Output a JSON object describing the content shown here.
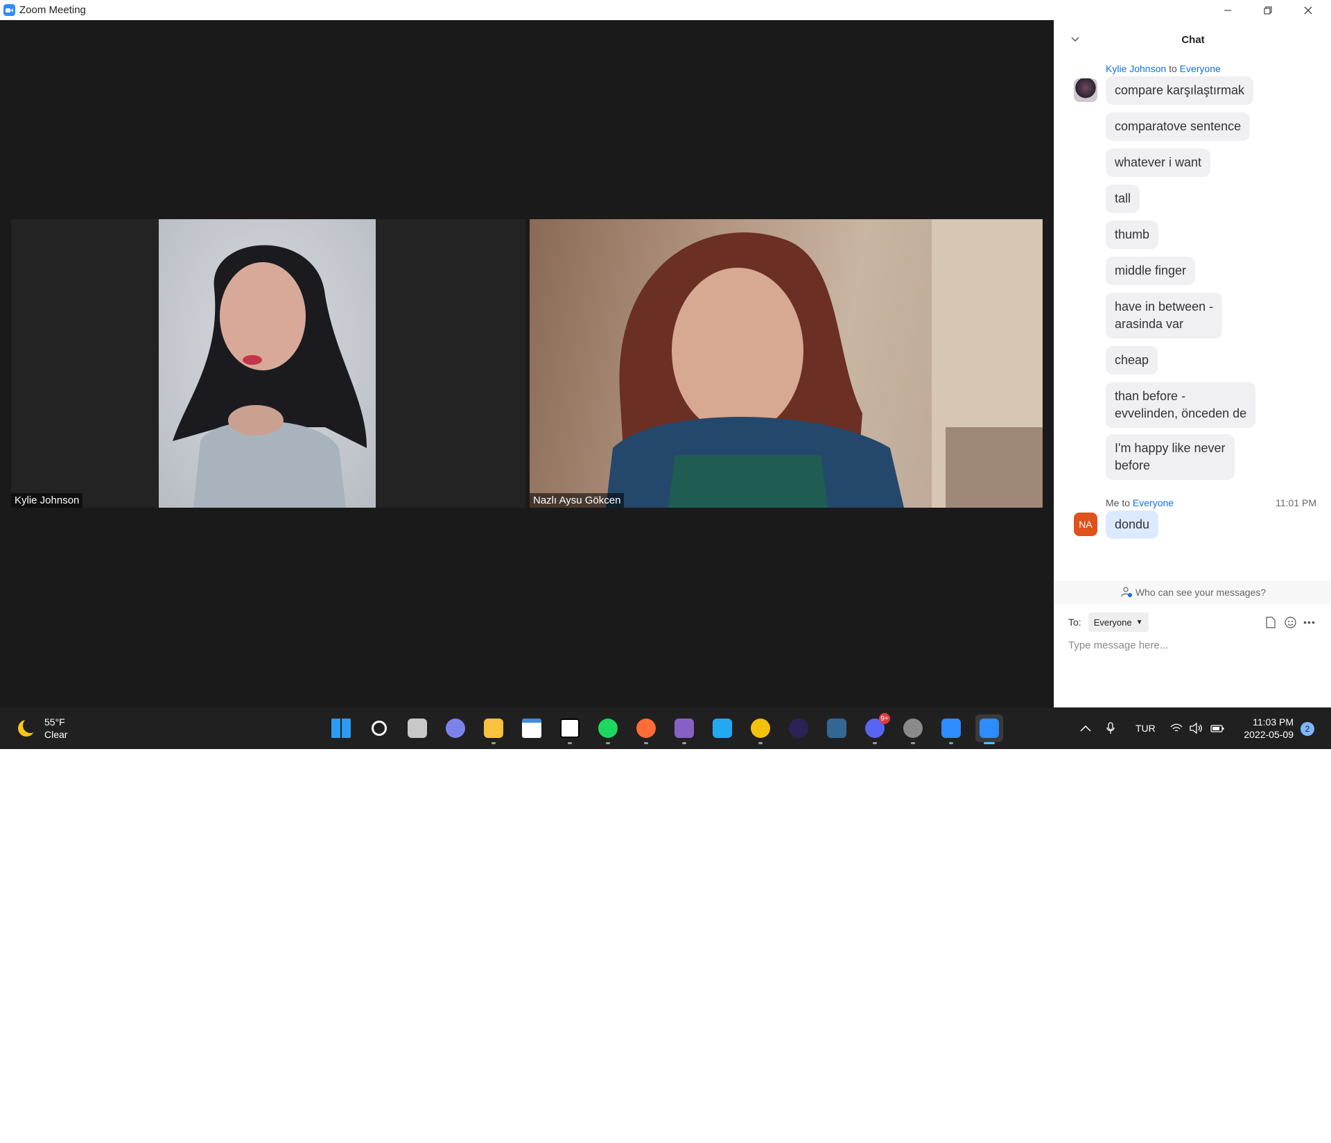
{
  "window": {
    "title": "Zoom Meeting"
  },
  "participants": [
    {
      "name": "Kylie Johnson"
    },
    {
      "name": "Nazlı Aysu Gökcen"
    }
  ],
  "chat": {
    "title": "Chat",
    "groups": [
      {
        "sender": "Kylie Johnson",
        "to_word": "to",
        "recipient": "Everyone",
        "time": "",
        "messages": [
          "compare karşılaştırmak",
          "comparatove sentence",
          "whatever i want",
          "tall",
          "thumb",
          "middle finger",
          "have in between -\narasinda var",
          "cheap",
          "than before -\nevvelinden, önceden de",
          "I'm happy like never\nbefore"
        ]
      },
      {
        "sender": "Me",
        "to_word": "to",
        "recipient": "Everyone",
        "time": "11:01 PM",
        "avatar_initials": "NA",
        "messages": [
          "dondu"
        ]
      }
    ],
    "privacy_text": "Who can see your messages?",
    "to_label": "To:",
    "to_value": "Everyone",
    "input_placeholder": "Type message here..."
  },
  "taskbar": {
    "weather": {
      "temp": "55°F",
      "condition": "Clear"
    },
    "apps": [
      {
        "name": "start",
        "color": "#2b9cf2"
      },
      {
        "name": "search",
        "color": "#ffffff"
      },
      {
        "name": "task-view",
        "color": "#c8c8c8"
      },
      {
        "name": "teams-chat",
        "color": "#7b83eb"
      },
      {
        "name": "file-explorer",
        "color": "#f9c23c"
      },
      {
        "name": "calendar-app",
        "color": "#ffffff"
      },
      {
        "name": "notion",
        "color": "#ffffff"
      },
      {
        "name": "spotify",
        "color": "#1ed760"
      },
      {
        "name": "postman",
        "color": "#ff6c37"
      },
      {
        "name": "visual-studio",
        "color": "#8661c5"
      },
      {
        "name": "vs-code",
        "color": "#23a9f2"
      },
      {
        "name": "chrome-canary",
        "color": "#f4c20d"
      },
      {
        "name": "eclipse",
        "color": "#2c2255"
      },
      {
        "name": "postgresql",
        "color": "#336791"
      },
      {
        "name": "discord",
        "color": "#5865f2",
        "badge": "9+"
      },
      {
        "name": "settings",
        "color": "#8a8a8a"
      },
      {
        "name": "zoom",
        "color": "#2d8cff"
      },
      {
        "name": "zoom-meeting",
        "color": "#2d8cff"
      }
    ],
    "language": "TUR",
    "clock": {
      "time": "11:03 PM",
      "date": "2022-05-09"
    },
    "notification_count": "2"
  }
}
